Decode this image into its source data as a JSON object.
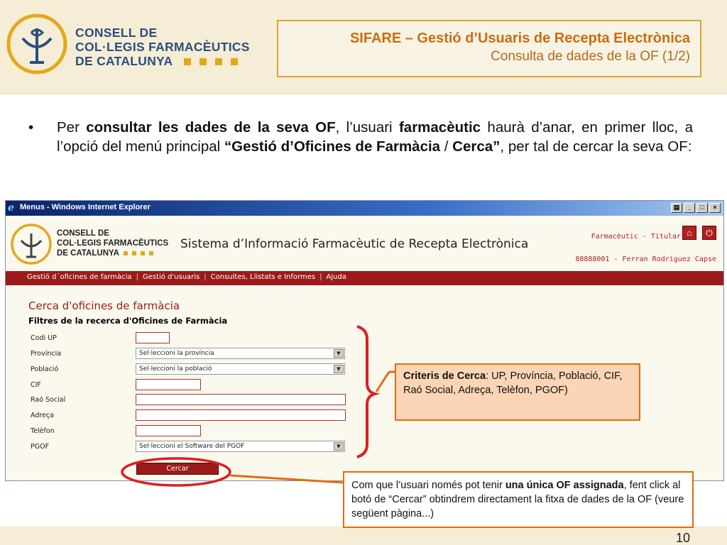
{
  "slide": {
    "logo_lines": [
      "CONSELL DE",
      "COL·LEGIS FARMACÈUTICS",
      "DE CATALUNYA"
    ],
    "title_main": "SIFARE – Gestió d’Usuaris de Recepta Electrònica",
    "title_sub": "Consulta de dades de la OF (1/2)",
    "bullet": "•",
    "page_number": "10",
    "colors": {
      "brand_blue": "#2c4f80",
      "accent_gold": "#e3a81a",
      "accent_orange": "#e36c0a",
      "title_orange": "#c96d12"
    }
  },
  "paragraph": {
    "t1": "Per ",
    "b1": "consultar les dades de la seva OF",
    "t2": ", l’usuari ",
    "b2": "farmacèutic",
    "t3": " haurà d’anar, en primer lloc, a l’opció del menú principal ",
    "b3": "“Gestió d’Oficines de Farmàcia",
    "t4": " / ",
    "b4": "Cerca”",
    "t5": ", per tal de cercar la seva OF:"
  },
  "browser": {
    "window_title": "Menus - Windows Internet Explorer",
    "app_logo_lines": [
      "CONSELL DE",
      "COL·LEGIS FARMACÈUTICS",
      "DE CATALUNYA"
    ],
    "app_title": "Sistema d’Informació Farmacèutic de Recepta Electrònica",
    "role": "Farmacèutic - Titular",
    "user": "88888001 - Ferran Rodríguez Capse",
    "nav": [
      "Gestió d´oficines de farmàcia",
      "Gestió d'usuaris",
      "Consultes, Llistats e Informes",
      "Ajuda"
    ],
    "nav_separator": "|",
    "page_heading": "Cerca d'oficines de farmàcia",
    "filter_heading": "Filtres de la recerca d'Oficines de Farmàcia",
    "fields": {
      "codi_up": {
        "label": "Codi UP",
        "value": ""
      },
      "provincia": {
        "label": "Província",
        "value": "Sel·leccioni la província"
      },
      "poblacio": {
        "label": "Població",
        "value": "Sel·leccioni la població"
      },
      "cif": {
        "label": "CIF",
        "value": ""
      },
      "rao_social": {
        "label": "Raó Social",
        "value": ""
      },
      "adreca": {
        "label": "Adreça",
        "value": ""
      },
      "telefon": {
        "label": "Telèfon",
        "value": ""
      },
      "pgof": {
        "label": "PGOF",
        "value": "Sel·leccioni el Software del PGOF"
      }
    },
    "search_button": "Cercar"
  },
  "callouts": {
    "criteria_bold": "Criteris de Cerca",
    "criteria_text": ": UP, Província, Població, CIF, Raó Social, Adreça, Telèfon, PGOF)",
    "note_t1": "Com que l’usuari només pot tenir ",
    "note_b1": "una única OF assignada",
    "note_t2": ", fent click al botó de “Cercar” obtindrem directament la fitxa de dades de la OF (veure següent pàgina...)"
  }
}
